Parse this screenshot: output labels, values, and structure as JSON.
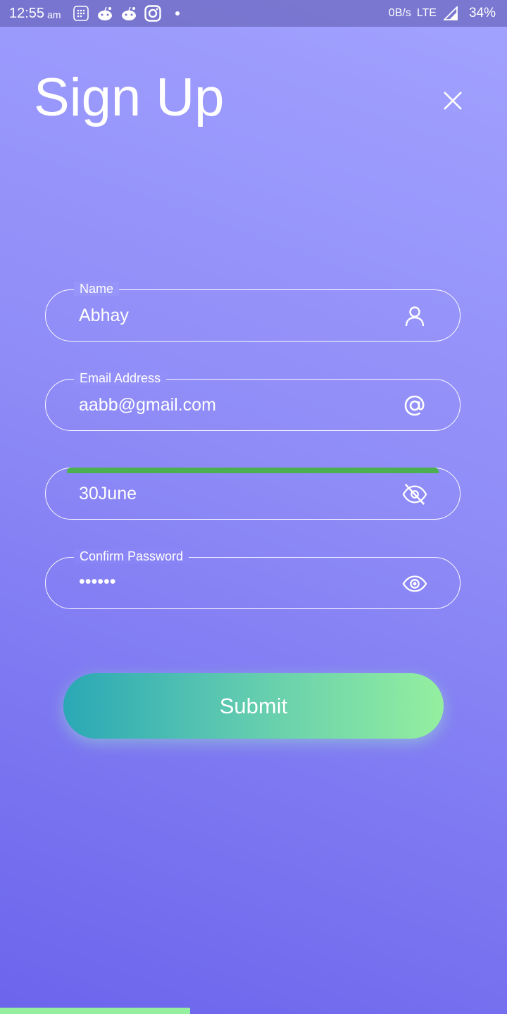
{
  "status_bar": {
    "time": "12:55",
    "ampm": "am",
    "net_speed": "0B/s",
    "network": "LTE",
    "battery": "34%",
    "icons": [
      "grid-app-icon",
      "reddit-icon",
      "reddit-icon",
      "instagram-icon",
      "notification-dot"
    ]
  },
  "page": {
    "title": "Sign Up",
    "close_icon": "close-icon"
  },
  "form": {
    "name": {
      "label": "Name",
      "value": "Abhay",
      "icon": "person-icon"
    },
    "email": {
      "label": "Email Address",
      "value": "aabb@gmail.com",
      "icon": "at-icon"
    },
    "password": {
      "value": "30June",
      "icon": "eye-off-icon",
      "strength_color": "#4caf50"
    },
    "confirm_password": {
      "label": "Confirm Password",
      "value": "••••••",
      "icon": "eye-icon"
    }
  },
  "submit": {
    "label": "Submit"
  },
  "colors": {
    "bg_top": "#a2a2ff",
    "bg_bottom": "#6c64ec",
    "submit_start": "#2aa8b5",
    "submit_end": "#94ef9f"
  }
}
